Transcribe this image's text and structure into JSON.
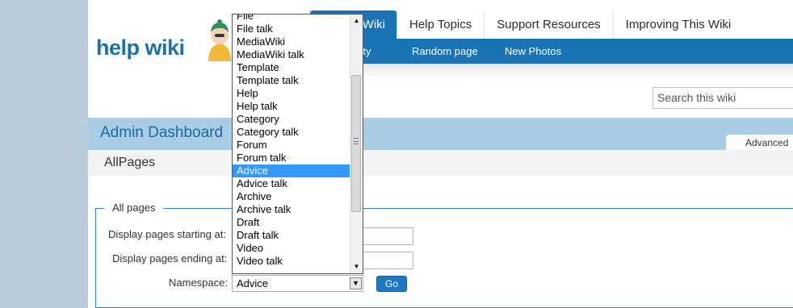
{
  "logo": {
    "text": "help wiki"
  },
  "tabs": [
    {
      "label": "Wiki"
    },
    {
      "label": "Help Topics"
    },
    {
      "label": "Support Resources"
    },
    {
      "label": "Improving This Wiki"
    }
  ],
  "subnav": [
    {
      "label": "ivity"
    },
    {
      "label": "Random page"
    },
    {
      "label": "New Photos"
    }
  ],
  "search": {
    "placeholder": "Search this wiki"
  },
  "dashboard": {
    "title": "Admin Dashboard",
    "advanced_tab": "Advanced"
  },
  "page": {
    "title": "AllPages"
  },
  "form": {
    "legend": "All pages",
    "start_label": "Display pages starting at:",
    "end_label": "Display pages ending at:",
    "namespace_label": "Namespace:",
    "namespace_value": "Advice",
    "go_label": "Go"
  },
  "dropdown": {
    "items": [
      "File",
      "File talk",
      "MediaWiki",
      "MediaWiki talk",
      "Template",
      "Template talk",
      "Help",
      "Help talk",
      "Category",
      "Category talk",
      "Forum",
      "Forum talk",
      "Advice",
      "Advice talk",
      "Archive",
      "Archive talk",
      "Draft",
      "Draft talk",
      "Video",
      "Video talk"
    ],
    "selected": "Advice"
  },
  "colors": {
    "accent": "#1a73b5",
    "dashboard_bar": "#a9cde4",
    "selection": "#3399ff",
    "frame": "#b8cdd9"
  }
}
